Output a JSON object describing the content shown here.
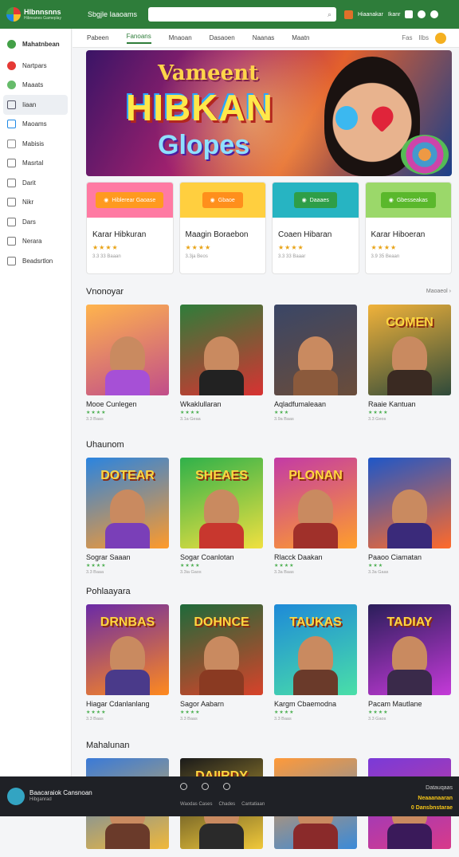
{
  "app": {
    "logo_text": "Hlbnnsnns",
    "logo_sub": "Hibreanes Gameplay",
    "title": "Sbgjle Iaaoams"
  },
  "search": {
    "placeholder": "",
    "icon": "search-icon"
  },
  "topbar": {
    "label_1": "Hiaanakar",
    "label_2": "Ikanr"
  },
  "sidebar": {
    "items": [
      {
        "label": "Mahatnbean",
        "icon": "logo-icon",
        "color": "#43a047"
      },
      {
        "label": "Nartpars",
        "icon": "target-icon",
        "color": "#e53935"
      },
      {
        "label": "Maaats",
        "icon": "leaf-icon",
        "color": "#66bb6a"
      },
      {
        "label": "Iiaan",
        "icon": "grid-icon",
        "color": "#556"
      },
      {
        "label": "Maoams",
        "icon": "calendar-icon",
        "color": "#1e88e5"
      },
      {
        "label": "Mabisis",
        "icon": "clock-icon",
        "color": "#888"
      },
      {
        "label": "Masrtal",
        "icon": "book-icon",
        "color": "#777"
      },
      {
        "label": "Darit",
        "icon": "doc-icon",
        "color": "#777"
      },
      {
        "label": "Nikr",
        "icon": "bag-icon",
        "color": "#777"
      },
      {
        "label": "Dars",
        "icon": "box-icon",
        "color": "#777"
      },
      {
        "label": "Nerara",
        "icon": "tool-icon",
        "color": "#777"
      },
      {
        "label": "Beadsrtlon",
        "icon": "settings-icon",
        "color": "#777"
      }
    ]
  },
  "subnav": {
    "tabs": [
      "Pabeen",
      "Fanoans",
      "Mnaoan",
      "Dasaoen",
      "Naanas",
      "Maatn"
    ],
    "right_1": "Fas",
    "right_2": "Ilbs"
  },
  "banner": {
    "title": "Vameent",
    "big": "HIBKAN",
    "sub": "Glopes"
  },
  "cards": [
    {
      "btn": "Hiblerear Gaoase",
      "title": "Karar Hibkuran",
      "stars": "★★★★",
      "meta": "3.3 33 Baaan",
      "head_color": "#ff7aa3",
      "btn_color": "#ff9a1f"
    },
    {
      "btn": "Gbaoe",
      "title": "Maagin Boraebon",
      "stars": "★★★★",
      "meta": "3.3ja Beos",
      "head_color": "#ffcf3f",
      "btn_color": "#ff8f1c"
    },
    {
      "btn": "Daaaes",
      "title": "Coaen Hibaran",
      "stars": "★★★★",
      "meta": "3.3 33 Baaar",
      "head_color": "#27b4c2",
      "btn_color": "#2e9e48"
    },
    {
      "btn": "Gbesseakas",
      "title": "Karar Hiboeran",
      "stars": "★★★★",
      "meta": "3.9 35 Beaan",
      "head_color": "#9bd86a",
      "btn_color": "#5ab82c"
    }
  ],
  "sections": [
    {
      "title": "Vnonoyar",
      "more": "Maoaeol ›",
      "items": [
        {
          "title": "Mooe Cunlegen",
          "stars": "★★★★",
          "meta": "3.3 Baas",
          "word": "",
          "c1": "#ffb44d",
          "c2": "#c14d8a",
          "body": "#a650d6"
        },
        {
          "title": "Wkaklullaran",
          "stars": "★★★★",
          "meta": "3.1a Geaa",
          "word": "",
          "c1": "#2e7d3a",
          "c2": "#d83232",
          "body": "#222"
        },
        {
          "title": "Aqladfumaleaan",
          "stars": "★★★",
          "meta": "3.9a Baas",
          "word": "",
          "c1": "#3a4666",
          "c2": "#6a4c3a",
          "body": "#8b5a3c"
        },
        {
          "title": "Raaie Kantuan",
          "stars": "★★★★",
          "meta": "3.3 Geos",
          "word": "COMEN",
          "c1": "#f0b23a",
          "c2": "#2f4a3a",
          "body": "#3a2a22"
        }
      ]
    },
    {
      "title": "Uhaunom",
      "more": "",
      "items": [
        {
          "title": "Sograr Saaan",
          "stars": "★★★★",
          "meta": "3.3 Baaa",
          "word": "DOTEAR",
          "c1": "#2a84e0",
          "c2": "#ff9a2a",
          "body": "#7a3fb8"
        },
        {
          "title": "Sogar Coanlotan",
          "stars": "★★★★",
          "meta": "3.3ia Gaos",
          "word": "SHEAES",
          "c1": "#2fb14a",
          "c2": "#f0e040",
          "body": "#c8372e"
        },
        {
          "title": "Rlacck Daakan",
          "stars": "★★★★",
          "meta": "3.3a Baas",
          "word": "PLONAN",
          "c1": "#c33aa6",
          "c2": "#ff9f2a",
          "body": "#a0302a"
        },
        {
          "title": "Paaoo Ciamatan",
          "stars": "★★★",
          "meta": "3.3a Gaas",
          "word": "",
          "c1": "#1e57c8",
          "c2": "#ff6a2a",
          "body": "#3a2a7a"
        }
      ]
    },
    {
      "title": "Pohlaayara",
      "more": "",
      "items": [
        {
          "title": "Hiagar Cdanlanlang",
          "stars": "★★★★",
          "meta": "3.3 Baas",
          "word": "DRNBAS",
          "c1": "#6a2aa6",
          "c2": "#ff8a1e",
          "body": "#4a3a8a"
        },
        {
          "title": "Sagor Aabarn",
          "stars": "★★★★",
          "meta": "3.3 Baas",
          "word": "DOHNCE",
          "c1": "#1e6a3a",
          "c2": "#d8422a",
          "body": "#8a3a22"
        },
        {
          "title": "Kargm Cbaemodna",
          "stars": "★★★★",
          "meta": "3.3 Baas",
          "word": "TAUKAS",
          "c1": "#1e8ad8",
          "c2": "#4adfa8",
          "body": "#6a3a2a"
        },
        {
          "title": "Pacam Mautlane",
          "stars": "★★★★",
          "meta": "3.3 Gaos",
          "word": "TADIAY",
          "c1": "#2a1e5a",
          "c2": "#c43ad8",
          "body": "#3a2a4a"
        }
      ]
    },
    {
      "title": "Mahalunan",
      "more": "",
      "items": [
        {
          "title": "",
          "stars": "",
          "meta": "",
          "word": "",
          "c1": "#3a7ad8",
          "c2": "#f0b83a",
          "body": "#6a3a2a"
        },
        {
          "title": "",
          "stars": "",
          "meta": "",
          "word": "DAIIRDY",
          "c1": "#1a1a1a",
          "c2": "#f0c83a",
          "body": "#2a2a2a"
        },
        {
          "title": "",
          "stars": "",
          "meta": "",
          "word": "",
          "c1": "#ff9a3a",
          "c2": "#3a8ad8",
          "body": "#8a2a2a"
        },
        {
          "title": "",
          "stars": "",
          "meta": "",
          "word": "",
          "c1": "#7a3ad8",
          "c2": "#d83a8a",
          "body": "#3a1a5a"
        }
      ]
    }
  ],
  "footer": {
    "brand": "Baacaraiok Cansnoan",
    "brand_sub": "Hibganrad",
    "links": [
      "Waodas Cases",
      "Chades",
      "Cantatiaan"
    ],
    "right_1": "Datauqaas",
    "right_2": "Neaaanaaran",
    "right_3": "0 Dansbnstarae"
  }
}
